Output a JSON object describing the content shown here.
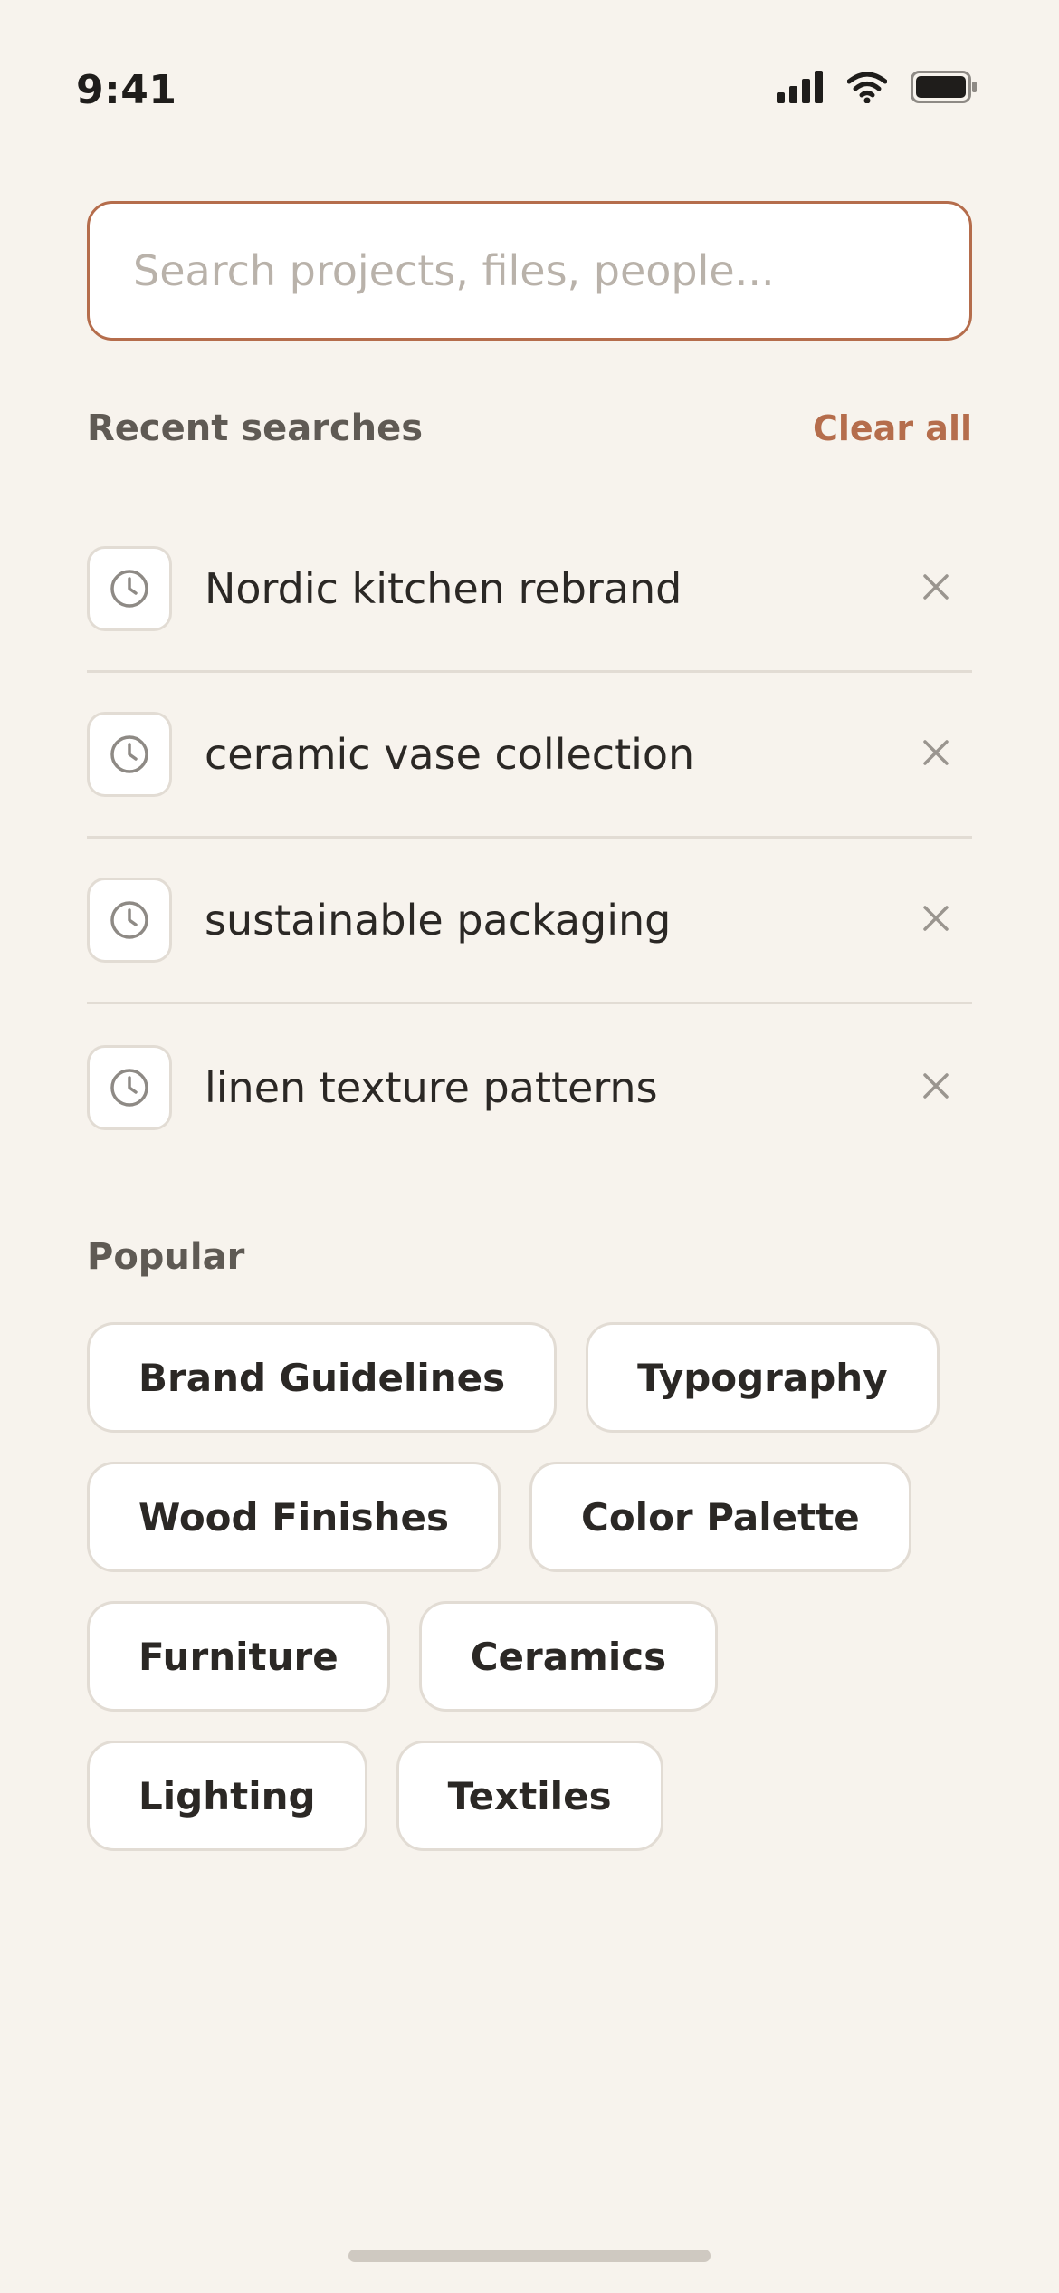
{
  "status_bar": {
    "time": "9:41",
    "icons": [
      "cellular-signal-icon",
      "wifi-icon",
      "battery-icon"
    ]
  },
  "search": {
    "placeholder": "Search projects, files, people...",
    "value": ""
  },
  "recent": {
    "title": "Recent searches",
    "clear_label": "Clear all",
    "items": [
      {
        "label": "Nordic kitchen rebrand",
        "icon": "clock-icon"
      },
      {
        "label": "ceramic vase collection",
        "icon": "clock-icon"
      },
      {
        "label": "sustainable packaging",
        "icon": "clock-icon"
      },
      {
        "label": "linen texture patterns",
        "icon": "clock-icon"
      }
    ]
  },
  "popular": {
    "title": "Popular",
    "chips": [
      "Brand Guidelines",
      "Typography",
      "Wood Finishes",
      "Color Palette",
      "Furniture",
      "Ceramics",
      "Lighting",
      "Textiles"
    ]
  },
  "colors": {
    "background": "#f7f3ed",
    "accent": "#b56d4c",
    "border": "#e2dcd4",
    "text": "#2b2825",
    "muted_text": "#5f5a54",
    "placeholder": "#b9b2aa"
  }
}
